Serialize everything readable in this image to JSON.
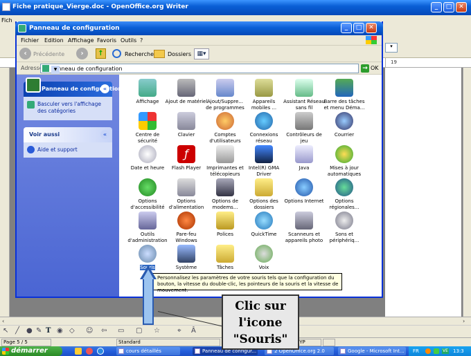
{
  "writer": {
    "title": "Fiche pratique_Vierge.doc - OpenOffice.org Writer",
    "menu_first": "Fich",
    "ruler_mark": "19",
    "status": {
      "page": "Page 5 / 5",
      "style": "Standard",
      "mode": "HYP"
    }
  },
  "control_panel": {
    "title": "Panneau de configuration",
    "menu": [
      "Fichier",
      "Edition",
      "Affichage",
      "Favoris",
      "Outils",
      "?"
    ],
    "toolbar": {
      "back": "Précédente",
      "search": "Rechercher",
      "folders": "Dossiers"
    },
    "address": {
      "label": "Adresse",
      "value": "Panneau de configuration",
      "go": "OK"
    },
    "sidebar": {
      "main_title": "Panneau de configuration",
      "switch_link": "Basculer vers l'affichage des catégories",
      "see_also_title": "Voir aussi",
      "help_link": "Aide et support"
    },
    "items": [
      "Affichage",
      "Ajout de matériel",
      "Ajout/Suppre... de programmes",
      "Appareils mobiles ...",
      "Assistant Réseau sans fil",
      "Barre des tâches et menu Déma...",
      "Centre de sécurité",
      "Clavier",
      "Comptes d'utilisateurs",
      "Connexions réseau",
      "Contrôleurs de jeu",
      "Courrier",
      "Date et heure",
      "Flash Player",
      "Imprimantes et télécopieurs",
      "Intel(R) GMA Driver",
      "Java",
      "Mises à jour automatiques",
      "Options d'accessibilité",
      "Options d'alimentation",
      "Options de modems...",
      "Options des dossiers",
      "Options Internet",
      "Options régionales...",
      "Outils d'administration",
      "Pare-feu Windows",
      "Polices",
      "QuickTime",
      "Scanneurs et appareils photo",
      "Sons et périphériq...",
      "Souris",
      "Système",
      "Tâches",
      "Voix"
    ],
    "tooltip": "Personnalisez les paramètres de votre souris tels que la configuration du bouton, la vitesse du double-clic, les pointeurs de la souris et la vitesse de mouvement."
  },
  "annotation": {
    "line1": "Clic sur",
    "line2": "l'icone",
    "line3": "\"Souris\""
  },
  "taskbar": {
    "start": "démarrer",
    "tasks": [
      "cours détaillés",
      "Panneau de configur...",
      "2 OpenOffice.org 2.0",
      "Google - Microsoft Int..."
    ],
    "lang": "FR",
    "clock": "13:3"
  }
}
